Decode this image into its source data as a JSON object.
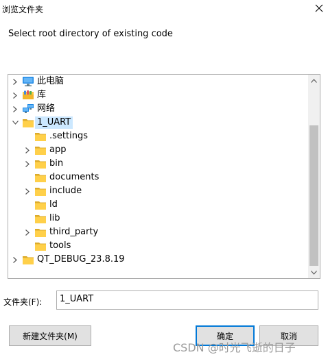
{
  "window": {
    "title": "浏览文件夹"
  },
  "prompt": "Select root directory of existing code",
  "tree": {
    "items": [
      {
        "label": "此电脑",
        "icon": "computer-icon",
        "expandable": true,
        "expanded": false,
        "selected": false,
        "level": 0
      },
      {
        "label": "库",
        "icon": "library-icon",
        "expandable": true,
        "expanded": false,
        "selected": false,
        "level": 0
      },
      {
        "label": "网络",
        "icon": "network-icon",
        "expandable": true,
        "expanded": false,
        "selected": false,
        "level": 0
      },
      {
        "label": "1_UART",
        "icon": "folder-icon",
        "expandable": true,
        "expanded": true,
        "selected": true,
        "level": 0
      },
      {
        "label": ".settings",
        "icon": "folder-icon",
        "expandable": false,
        "expanded": false,
        "selected": false,
        "level": 1
      },
      {
        "label": "app",
        "icon": "folder-icon",
        "expandable": true,
        "expanded": false,
        "selected": false,
        "level": 1
      },
      {
        "label": "bin",
        "icon": "folder-icon",
        "expandable": true,
        "expanded": false,
        "selected": false,
        "level": 1
      },
      {
        "label": "documents",
        "icon": "folder-icon",
        "expandable": false,
        "expanded": false,
        "selected": false,
        "level": 1
      },
      {
        "label": "include",
        "icon": "folder-icon",
        "expandable": true,
        "expanded": false,
        "selected": false,
        "level": 1
      },
      {
        "label": "ld",
        "icon": "folder-icon",
        "expandable": false,
        "expanded": false,
        "selected": false,
        "level": 1
      },
      {
        "label": "lib",
        "icon": "folder-icon",
        "expandable": false,
        "expanded": false,
        "selected": false,
        "level": 1
      },
      {
        "label": "third_party",
        "icon": "folder-icon",
        "expandable": true,
        "expanded": false,
        "selected": false,
        "level": 1
      },
      {
        "label": "tools",
        "icon": "folder-icon",
        "expandable": false,
        "expanded": false,
        "selected": false,
        "level": 1
      },
      {
        "label": "QT_DEBUG_23.8.19",
        "icon": "folder-icon",
        "expandable": true,
        "expanded": false,
        "selected": false,
        "level": 0
      }
    ]
  },
  "folder": {
    "label": "文件夹(F):",
    "value": "1_UART"
  },
  "buttons": {
    "new_folder": "新建文件夹(M)",
    "ok": "确定",
    "cancel": "取消"
  },
  "watermark": "CSDN @时光飞逝的日子",
  "colors": {
    "selection": "#cce8ff",
    "folder": "#ffd04a",
    "accent": "#0078d7"
  }
}
